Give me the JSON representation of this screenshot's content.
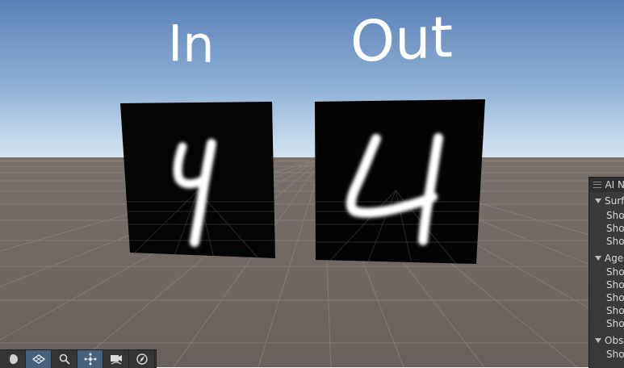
{
  "scene": {
    "labels": {
      "input": "In",
      "output": "Out"
    },
    "colors": {
      "sky_top": "#5a80b6",
      "horizon": "#c9dcee",
      "ground": "#6e6460",
      "grid": "#8f8783",
      "digit": "#ffffff"
    }
  },
  "ai_navigation_panel": {
    "title": "AI N",
    "sections": [
      {
        "label": "Surf",
        "options": [
          "Sho",
          "Sho",
          "Sho"
        ]
      },
      {
        "label": "Age",
        "options": [
          "Sho",
          "Sho",
          "Sho",
          "Sho",
          "Sho"
        ]
      },
      {
        "label": "Obs",
        "options": [
          "Sho"
        ]
      }
    ]
  },
  "toolbar": {
    "tools": [
      {
        "icon": "lighting-toggle-icon",
        "active": false
      },
      {
        "icon": "navmesh-surface-icon",
        "active": true
      },
      {
        "icon": "magnifier-icon",
        "active": false
      },
      {
        "icon": "agent-move-icon",
        "active": true
      },
      {
        "icon": "camera-icon",
        "active": false
      },
      {
        "icon": "compass-icon",
        "active": false
      }
    ]
  }
}
